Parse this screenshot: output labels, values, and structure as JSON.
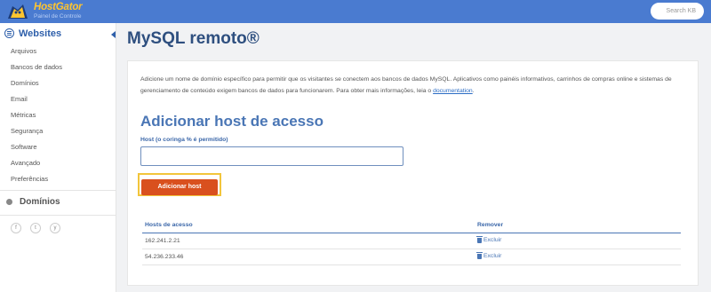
{
  "brand": {
    "name": "HostGator",
    "subtitle": "Painel de Controle"
  },
  "search": {
    "placeholder": "Search KB"
  },
  "sidebar": {
    "section_title": "Websites",
    "items": [
      {
        "label": "Arquivos"
      },
      {
        "label": "Bancos de dados"
      },
      {
        "label": "Domínios"
      },
      {
        "label": "Email"
      },
      {
        "label": "Métricas"
      },
      {
        "label": "Segurança"
      },
      {
        "label": "Software"
      },
      {
        "label": "Avançado"
      },
      {
        "label": "Preferências"
      }
    ],
    "section2_title": "Domínios",
    "social": [
      "f",
      "t",
      "y"
    ]
  },
  "main": {
    "title": "MySQL remoto®",
    "description": "Adicione um nome de domínio específico para permitir que os visitantes se conectem aos bancos de dados MySQL. Aplicativos como painéis informativos, carrinhos de compras online e sistemas de gerenciamento de conteúdo exigem bancos de dados para funcionarem. Para obter mais informações, leia o ",
    "doc_link": "documentation",
    "doc_suffix": ".",
    "section_title": "Adicionar host de acesso",
    "field_label": "Host (o coringa % é permitido)",
    "host_value": "",
    "add_button": "Adicionar host",
    "table": {
      "headers": {
        "host": "Hosts de acesso",
        "remove": "Remover"
      },
      "rows": [
        {
          "host": "162.241.2.21",
          "action": "Excluir"
        },
        {
          "host": "54.236.233.46",
          "action": "Excluir"
        }
      ]
    }
  },
  "colors": {
    "topbar": "#4a7bd0",
    "accent": "#2e5faa",
    "button": "#d9501e",
    "highlight": "#f2c53b"
  }
}
